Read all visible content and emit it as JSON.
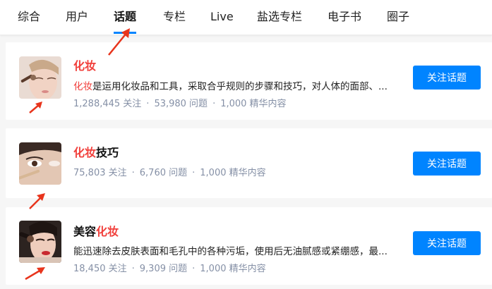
{
  "tabs": [
    {
      "label": "综合",
      "active": false
    },
    {
      "label": "用户",
      "active": false
    },
    {
      "label": "话题",
      "active": true
    },
    {
      "label": "专栏",
      "active": false
    },
    {
      "label": "Live",
      "active": false
    },
    {
      "label": "盐选专栏",
      "active": false
    },
    {
      "label": "电子书",
      "active": false
    },
    {
      "label": "圈子",
      "active": false
    }
  ],
  "results": [
    {
      "title_highlight": "化妆",
      "title_after": "",
      "title_before": "",
      "excerpt_highlight": "化妆",
      "excerpt_rest": "是运用化妆品和工具，采取合乎规则的步骤和技巧，对人体的面部、...",
      "followers": "1,288,445 关注",
      "questions": "53,980 问题",
      "essence": "1,000 精华内容",
      "button": "关注话题"
    },
    {
      "title_before": "",
      "title_highlight": "化妆",
      "title_after": "技巧",
      "followers": "75,803 关注",
      "questions": "6,760 问题",
      "essence": "1,000 精华内容",
      "button": "关注话题"
    },
    {
      "title_before": "美容",
      "title_highlight": "化妆",
      "title_after": "",
      "excerpt_rest": "能迅速除去皮肤表面和毛孔中的各种污垢，使用后无油腻感或紧绷感，最...",
      "followers": "18,450 关注",
      "questions": "9,309 问题",
      "essence": "1,000 精华内容",
      "button": "关注话题"
    }
  ],
  "meta_separator": "·",
  "colors": {
    "accent": "#0084ff",
    "highlight": "#f1403c",
    "annotation_arrow": "#e8341c"
  }
}
